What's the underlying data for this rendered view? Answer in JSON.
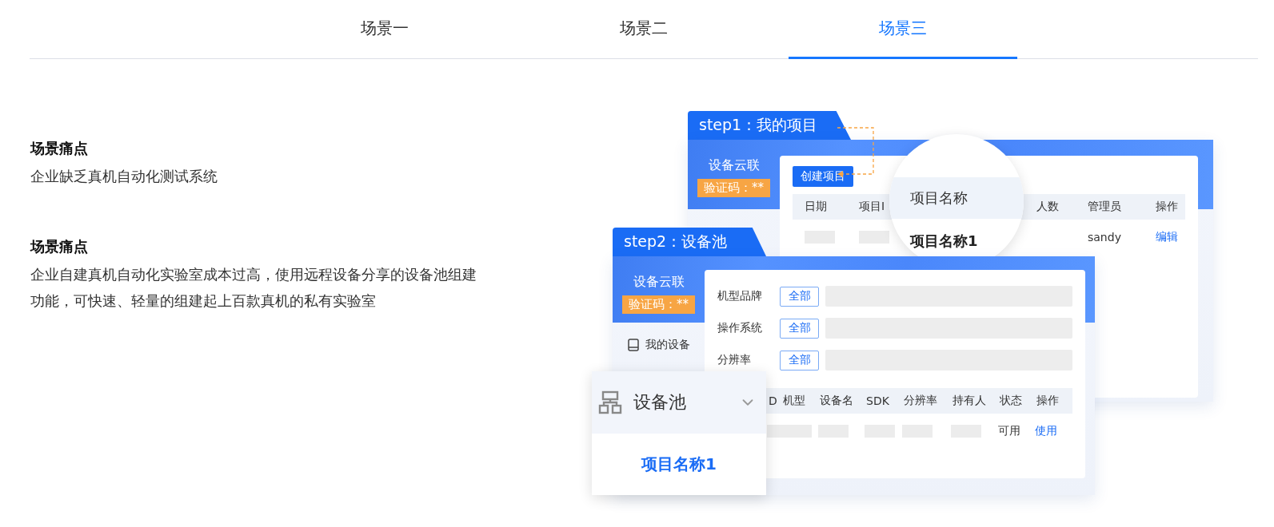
{
  "tabs": [
    {
      "label": "场景一",
      "selected": false
    },
    {
      "label": "场景二",
      "selected": false
    },
    {
      "label": "场景三",
      "selected": true
    }
  ],
  "scenarios": [
    {
      "title": "场景痛点",
      "description": "企业缺乏真机自动化测试系统"
    },
    {
      "title": "场景痛点",
      "description": "企业自建真机自动化实验室成本过高，使用远程设备分享的设备池组建功能，可快速、轻量的组建起上百款真机的私有实验室"
    }
  ],
  "illustration": {
    "step1": {
      "tab": "step1：我的项目",
      "brand": "设备云联",
      "badge": "验证码：**",
      "create_button": "创建项目",
      "columns": [
        "日期",
        "项目I",
        "",
        "人数",
        "管理员",
        "操作"
      ],
      "row": [
        {
          "kind": "blank"
        },
        {
          "kind": "blank"
        },
        {
          "kind": "none"
        },
        {
          "kind": "none"
        },
        {
          "kind": "text",
          "text": "sandy"
        },
        {
          "kind": "link",
          "text": "编辑"
        }
      ],
      "magnifier": {
        "header": "项目名称",
        "value": "项目名称1"
      }
    },
    "step2": {
      "tab": "step2：设备池",
      "brand": "设备云联",
      "badge": "验证码：**",
      "menu_item": "我的设备",
      "filters": [
        {
          "label": "机型品牌",
          "value": "全部"
        },
        {
          "label": "操作系统",
          "value": "全部"
        },
        {
          "label": "分辨率",
          "value": "全部"
        }
      ],
      "columns": [
        "D",
        "机型",
        "设备名",
        "SDK",
        "分辨率",
        "持有人",
        "状态",
        "操作"
      ],
      "row": [
        {
          "kind": "blank"
        },
        {
          "kind": "blank"
        },
        {
          "kind": "blank"
        },
        {
          "kind": "blank"
        },
        {
          "kind": "blank"
        },
        {
          "kind": "blank"
        },
        {
          "kind": "text",
          "text": "可用"
        },
        {
          "kind": "link",
          "text": "使用"
        }
      ]
    },
    "dropdown": {
      "label": "设备池",
      "item": "项目名称1"
    }
  }
}
